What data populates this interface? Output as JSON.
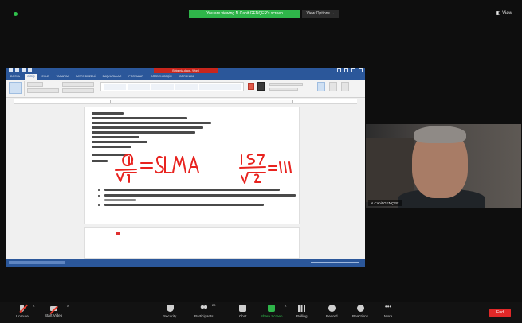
{
  "share_banner": {
    "text": "You are viewing N.Cahit GENÇER's screen",
    "view_options": "View Options ⌄",
    "view_button": "◧ View"
  },
  "word": {
    "title": "Belgeniz.docx - Word",
    "tabs": [
      "DOSYA",
      "GİRİŞ",
      "EKLE",
      "TASARIM",
      "SAYFA DÜZENİ",
      "BAŞVURULAR",
      "POSTALAR",
      "GÖZDEN GEÇİR",
      "GÖRÜNÜM"
    ],
    "active_tab": "GİRİŞ"
  },
  "video": {
    "participant_name": "N.Cahit GENÇER"
  },
  "toolbar": {
    "unmute": "Unmute",
    "start_video": "Start Video",
    "security": "Security",
    "participants": "Participants",
    "participants_count": "20",
    "chat": "Chat",
    "share_screen": "Share Screen",
    "polling": "Polling",
    "record": "Record",
    "reactions": "Reactions",
    "more": "More",
    "end": "End"
  },
  "colors": {
    "zoom_green": "#2fb54a",
    "word_blue": "#2b579a",
    "end_red": "#e02828"
  }
}
